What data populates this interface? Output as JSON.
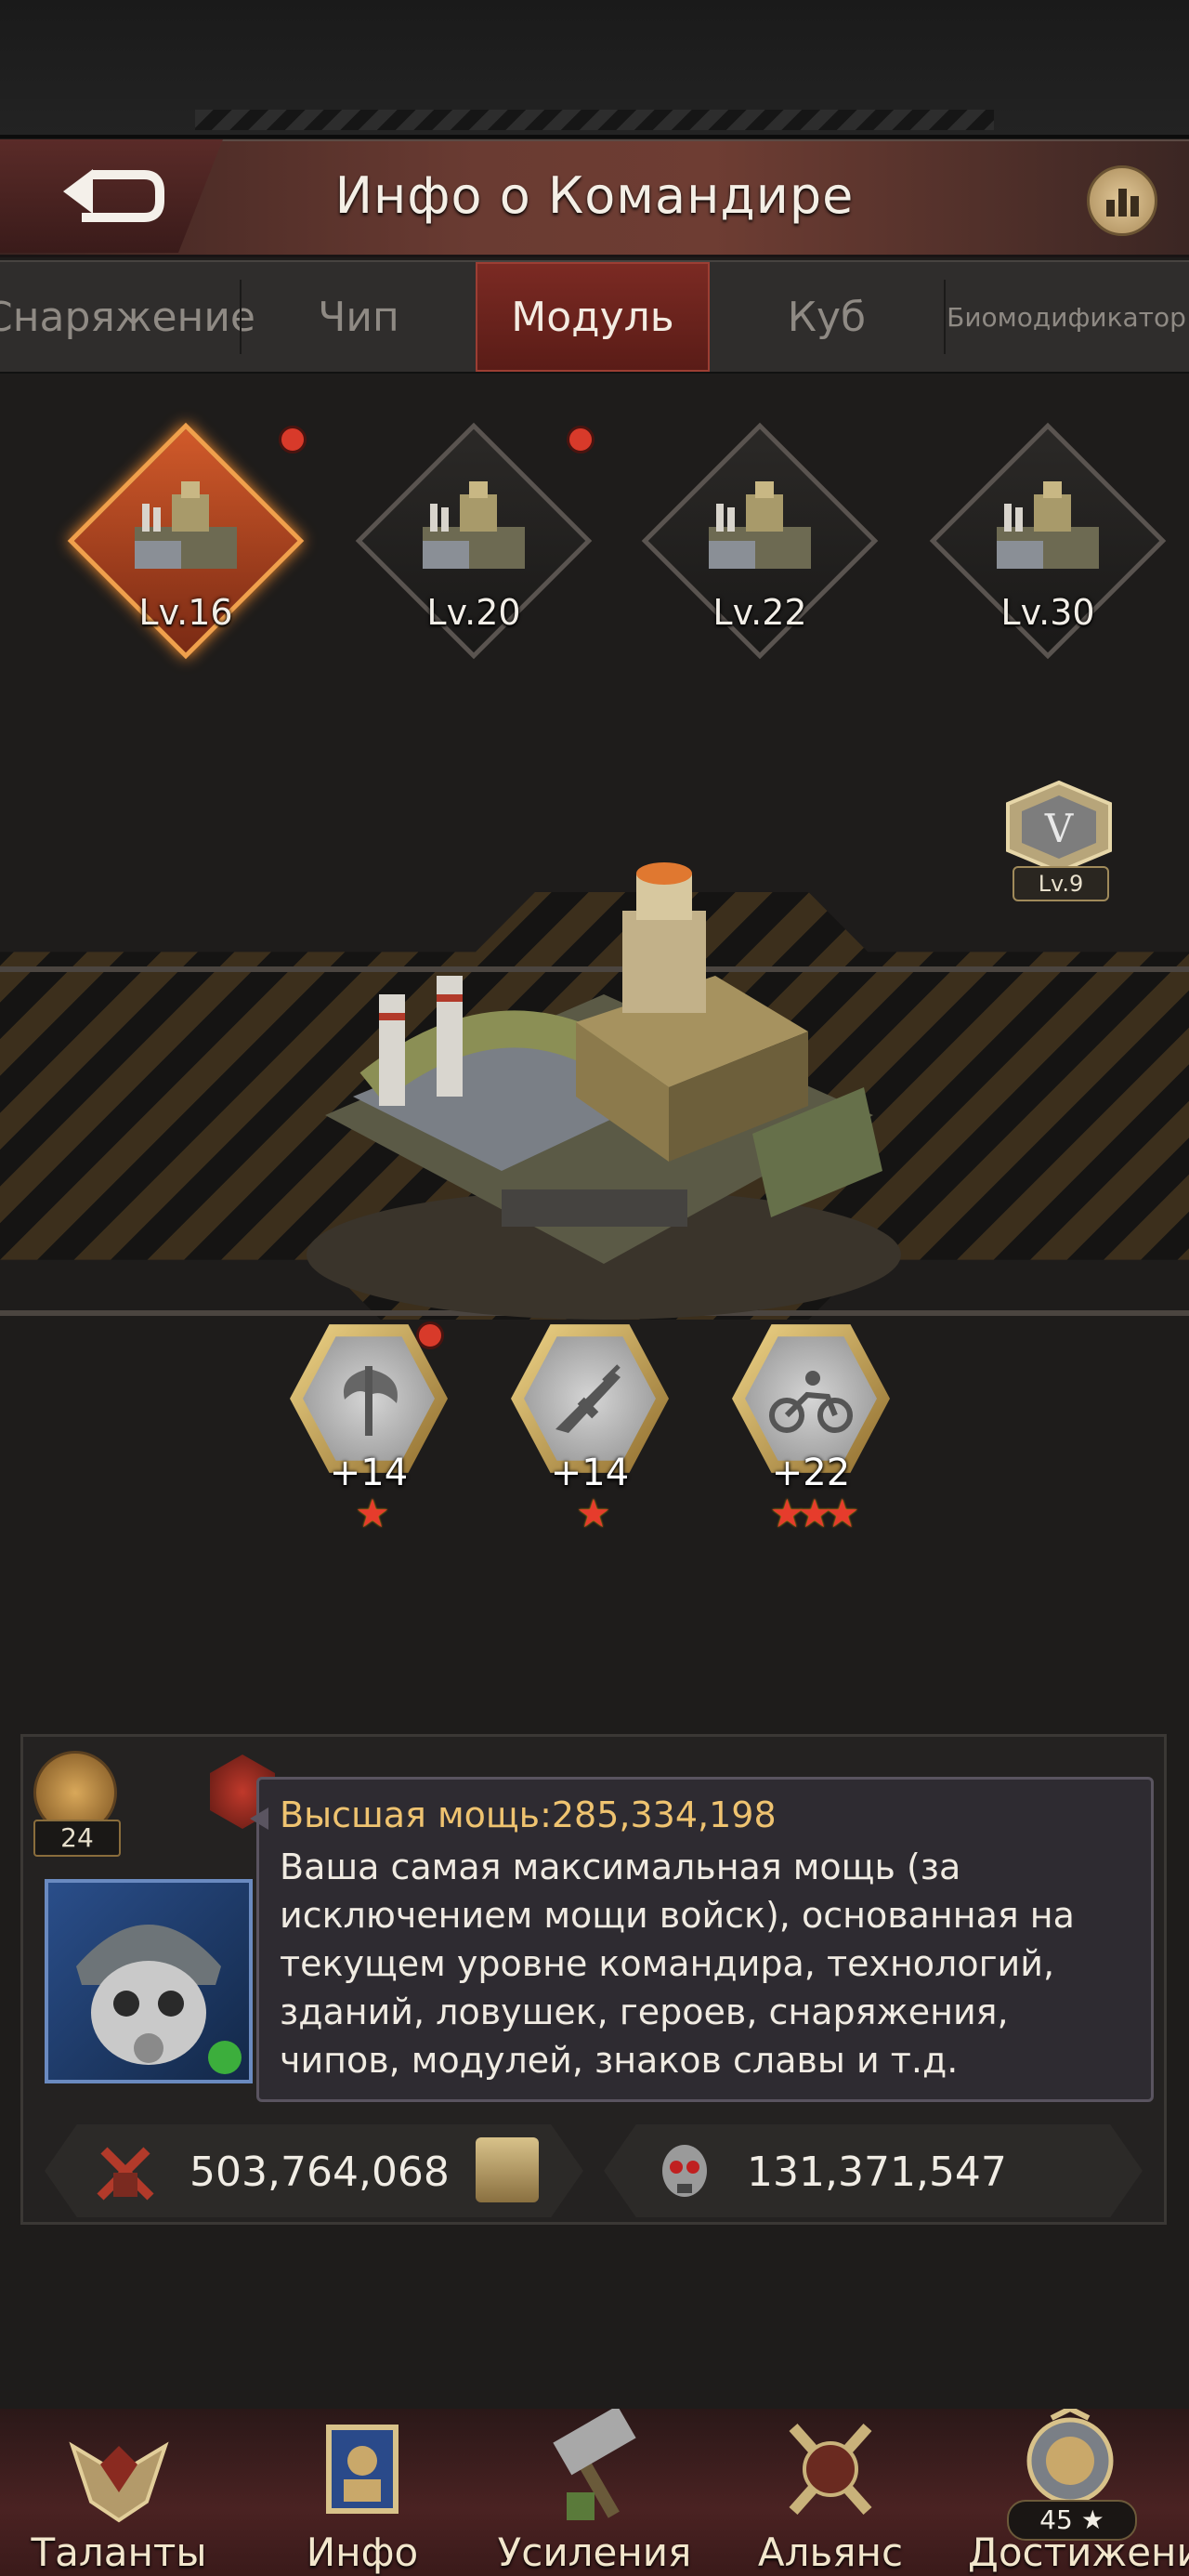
{
  "header": {
    "title": "Инфо о Командире"
  },
  "tabs": [
    {
      "label": "Снаряжение"
    },
    {
      "label": "Чип"
    },
    {
      "label": "Модуль"
    },
    {
      "label": "Куб"
    },
    {
      "label": "Биомодификатор"
    }
  ],
  "active_tab": "Модуль",
  "modules": [
    {
      "level": "Lv.16",
      "selected": true,
      "alert": true
    },
    {
      "level": "Lv.20",
      "selected": false,
      "alert": true
    },
    {
      "level": "Lv.22",
      "selected": false,
      "alert": false
    },
    {
      "level": "Lv.30",
      "selected": false,
      "alert": false
    }
  ],
  "module_detail": {
    "rank_level": "Lv.9",
    "skills": [
      {
        "icon": "axe-icon",
        "bonus": "+14",
        "stars": "★"
      },
      {
        "icon": "rifle-icon",
        "bonus": "+14",
        "stars": "★"
      },
      {
        "icon": "motorcycle-icon",
        "bonus": "+22",
        "stars": "★★★"
      }
    ]
  },
  "commander": {
    "badge_count": "24",
    "tooltip_title": "Высшая мощь:285,334,198",
    "tooltip_body": "Ваша самая максимальная мощь (за исключением мощи войск), основанная на текущем уровне командира, технологий, зданий, ловушек, героев, снаряжения, чипов, модулей, знаков славы и т.д.",
    "power": "503,764,068",
    "kills": "131,371,547"
  },
  "bottom_nav": [
    {
      "label": "Таланты",
      "icon": "wings-emblem-icon"
    },
    {
      "label": "Инфо",
      "icon": "commander-info-icon"
    },
    {
      "label": "Усиления",
      "icon": "hammer-icon"
    },
    {
      "label": "Альянс",
      "icon": "crossed-swords-icon"
    },
    {
      "label": "Достижение",
      "icon": "lion-trophy-icon",
      "count": "45 ★"
    }
  ],
  "colors": {
    "accent": "#7b2a23",
    "gold": "#efc370",
    "alert": "#d83a2a"
  }
}
